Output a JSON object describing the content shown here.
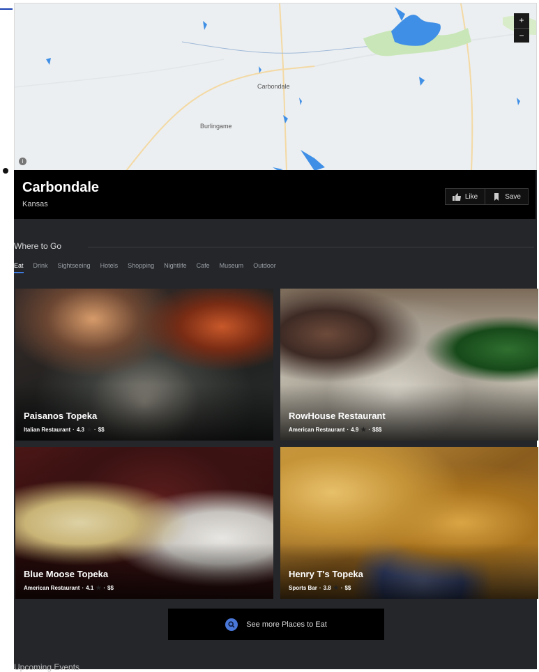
{
  "map": {
    "labels": {
      "carbondale": "Carbondale",
      "burlingame": "Burlingame"
    },
    "zoom_in": "+",
    "zoom_out": "−",
    "info": "i"
  },
  "city": {
    "name": "Carbondale",
    "state": "Kansas"
  },
  "actions": {
    "like": "Like",
    "save": "Save"
  },
  "where_to_go": {
    "title": "Where to Go",
    "tabs": [
      "Eat",
      "Drink",
      "Sightseeing",
      "Hotels",
      "Shopping",
      "Nightlife",
      "Cafe",
      "Museum",
      "Outdoor"
    ],
    "active_tab": "Eat"
  },
  "places": [
    {
      "name": "Paisanos Topeka",
      "type": "Italian Restaurant",
      "rating": "4.3",
      "price": "$$"
    },
    {
      "name": "RowHouse Restaurant",
      "type": "American Restaurant",
      "rating": "4.9",
      "price": "$$$"
    },
    {
      "name": "Blue Moose Topeka",
      "type": "American Restaurant",
      "rating": "4.1",
      "price": "$$"
    },
    {
      "name": "Henry T's Topeka",
      "type": "Sports Bar",
      "rating": "3.8",
      "price": "$$"
    }
  ],
  "see_more": "See more Places to Eat",
  "upcoming_events": "Upcoming Events",
  "colors": {
    "accent": "#3d7be0",
    "panel": "#24262a",
    "header": "#000000"
  }
}
